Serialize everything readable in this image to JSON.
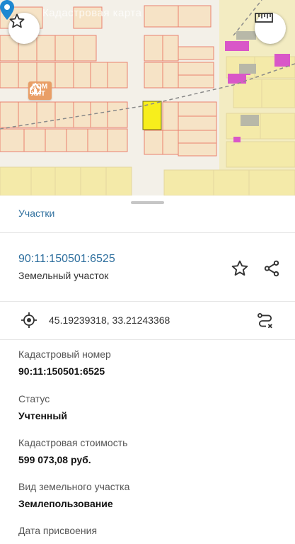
{
  "map": {
    "watermark": "Кадастровая карта",
    "badge": {
      "line1": "ДОМ",
      "line2": "ХИТ"
    },
    "colors": {
      "parcel_fill": "#f6e9c2",
      "parcel_border": "#e9826f",
      "selected": "#f7ee1c",
      "marker": "#1e88d1"
    }
  },
  "sheet": {
    "tab_label": "Участки",
    "parcel": {
      "number": "90:11:150501:6525",
      "type": "Земельный участок"
    },
    "coordinates": "45.19239318, 33.21243368",
    "properties": [
      {
        "label": "Кадастровый номер",
        "value": "90:11:150501:6525"
      },
      {
        "label": "Статус",
        "value": "Учтенный"
      },
      {
        "label": "Кадастровая стоимость",
        "value": "599 073,08 руб."
      },
      {
        "label": "Вид земельного участка",
        "value": "Землепользование"
      },
      {
        "label": "Дата присвоения",
        "value": ""
      }
    ]
  }
}
